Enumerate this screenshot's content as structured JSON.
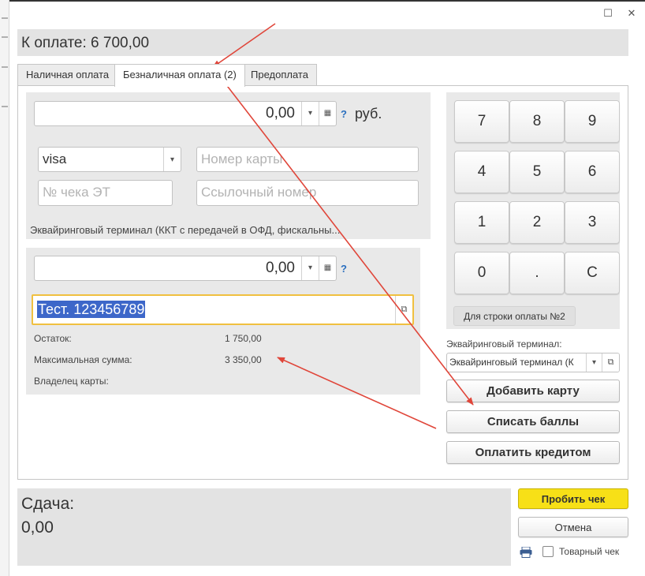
{
  "header": {
    "title": "К оплате: 6 700,00"
  },
  "window": {
    "maximize_symbol": "☐",
    "close_symbol": "✕"
  },
  "tabs": [
    {
      "label": "Наличная оплата"
    },
    {
      "label": "Безналичная оплата (2)"
    },
    {
      "label": "Предоплата"
    }
  ],
  "payment1": {
    "amount": "0,00",
    "currency": "руб.",
    "help": "?",
    "card_type": "visa",
    "card_number_placeholder": "Номер карты",
    "receipt_placeholder": "№ чека ЭТ",
    "reference_placeholder": "Ссылочный номер",
    "terminal_text": "Эквайринговый терминал  (ККТ с передачей в ОФД, фискальны..."
  },
  "payment2": {
    "amount": "0,00",
    "help": "?",
    "card_value": "Тест. 123456789",
    "remainder_label": "Остаток:",
    "remainder_value": "1 750,00",
    "max_label": "Максимальная сумма:",
    "max_value": "3 350,00",
    "owner_label": "Владелец карты:"
  },
  "keypad": {
    "keys": [
      "7",
      "8",
      "9",
      "4",
      "5",
      "6",
      "1",
      "2",
      "3",
      "0",
      ".",
      "C"
    ],
    "row_label": "Для строки оплаты №2"
  },
  "terminal": {
    "label": "Эквайринговый терминал:",
    "value": "Эквайринговый терминал  (К"
  },
  "actions": {
    "add_card": "Добавить карту",
    "write_off_points": "Списать баллы",
    "pay_credit": "Оплатить кредитом"
  },
  "change": {
    "label": "Сдача:",
    "value": "0,00"
  },
  "footer": {
    "print_receipt": "Пробить чек",
    "cancel": "Отмена",
    "goods_receipt": "Товарный чек"
  },
  "colors": {
    "annotation_arrow": "#e0463a",
    "print_button": "#f7e017",
    "selection": "#3d67c9",
    "focus_border": "#f0c040"
  }
}
